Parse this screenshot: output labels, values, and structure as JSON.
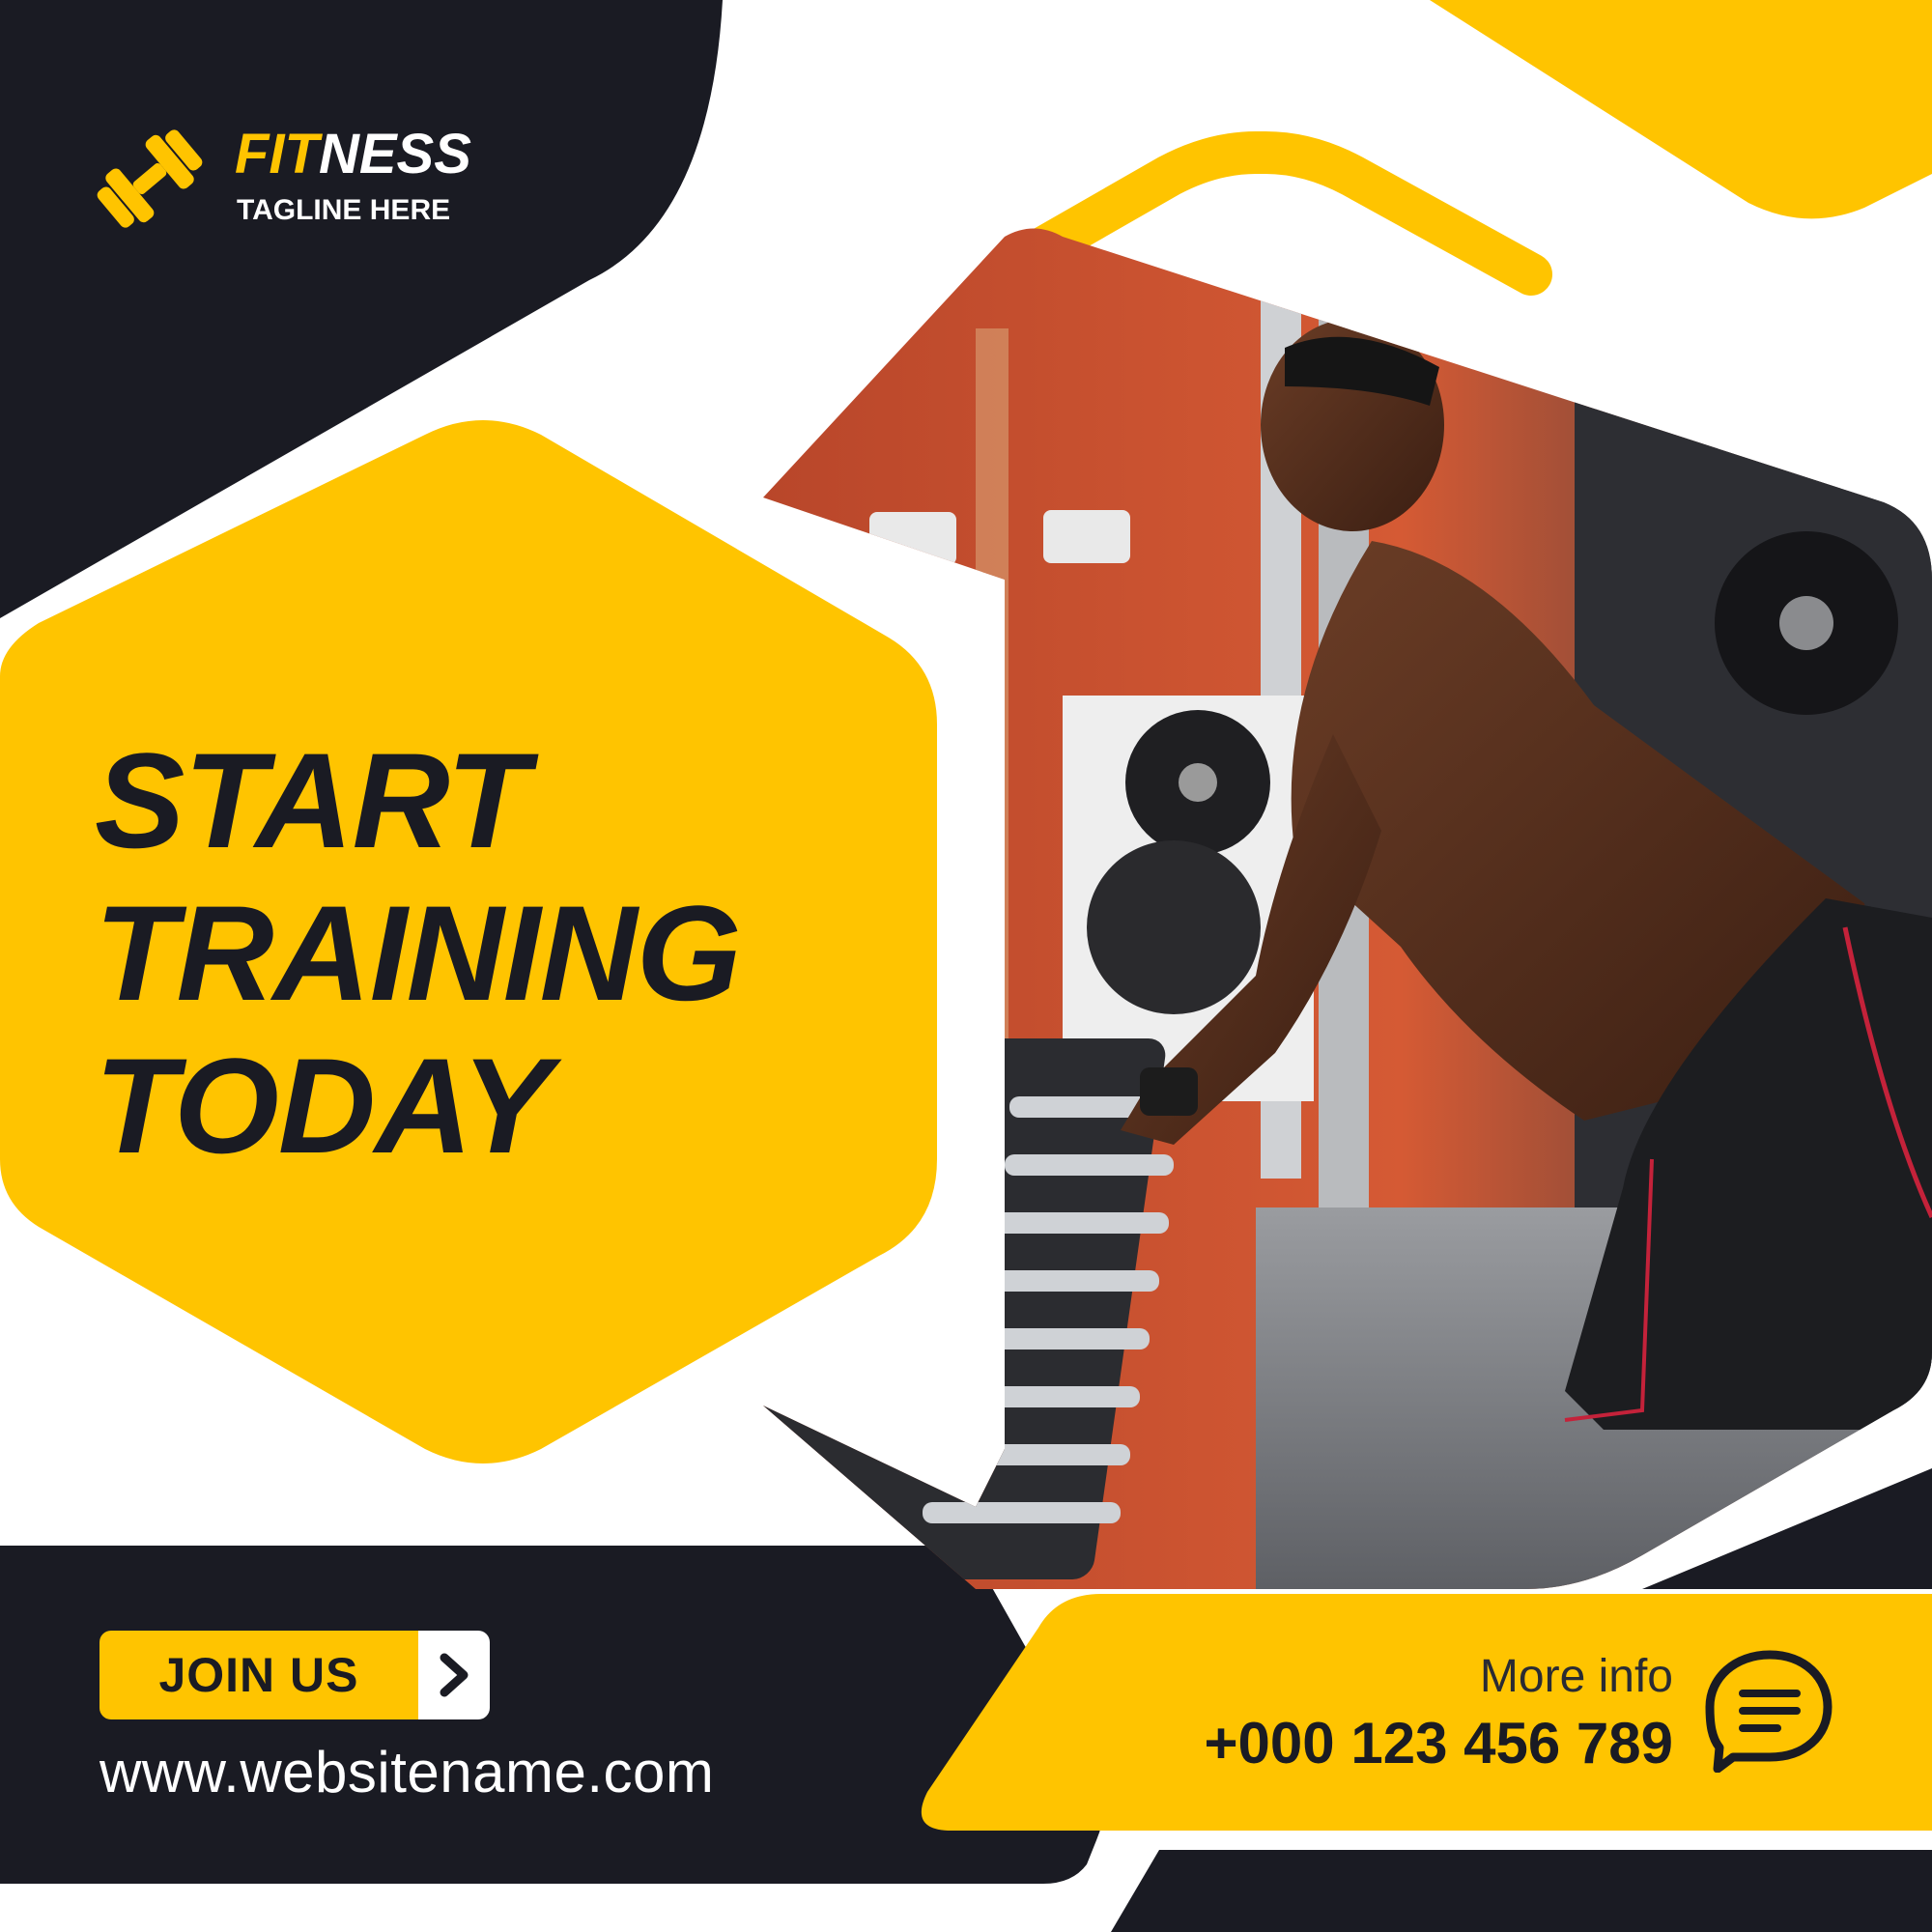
{
  "colors": {
    "accent": "#ffc400",
    "dark": "#1a1b23",
    "background": "#ffffff"
  },
  "brand": {
    "title_part1": "FIT",
    "title_part2": "NESS",
    "tagline": "TAGLINE HERE",
    "logo_icon": "dumbbell-icon"
  },
  "headline": {
    "line1": "START",
    "line2": "TRAINING",
    "line3": "TODAY"
  },
  "cta": {
    "join_label": "JOIN US",
    "arrow_icon": "chevron-right-icon"
  },
  "website": "www.websitename.com",
  "contact": {
    "label": "More info",
    "phone": "+000 123 456 789",
    "icon": "chat-bubble-icon"
  },
  "photo": {
    "subject": "gym-photo"
  }
}
